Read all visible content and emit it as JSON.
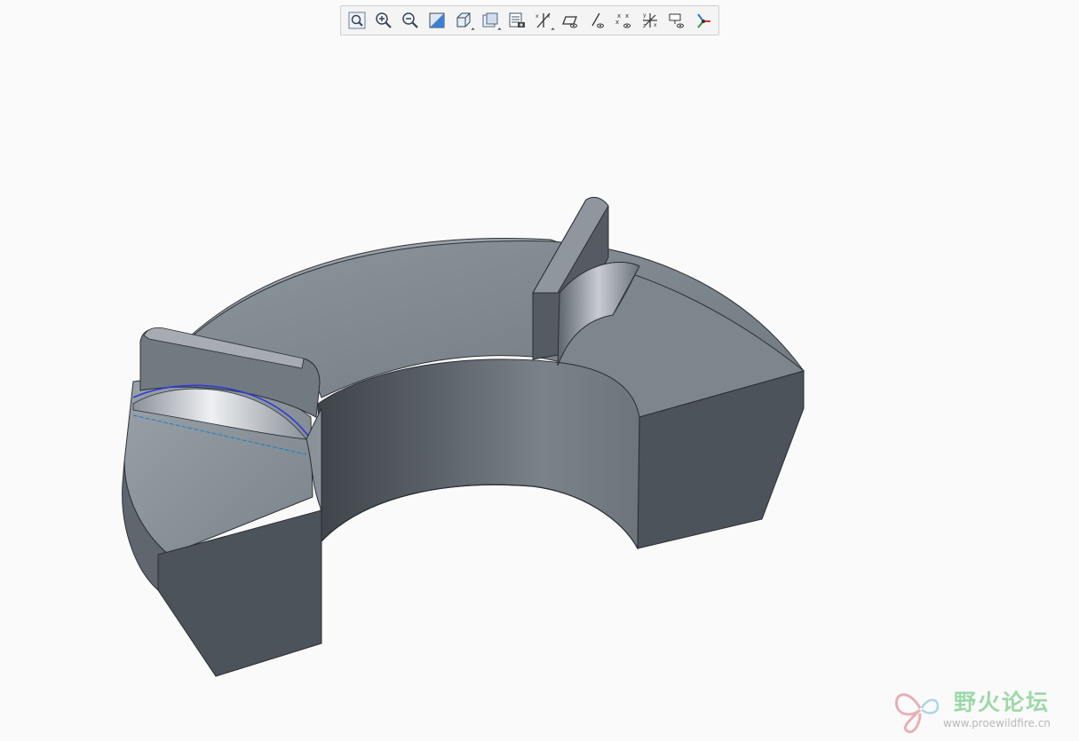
{
  "toolbar": {
    "buttons": [
      {
        "name": "refit",
        "icon": "refit-icon",
        "dropdown": false
      },
      {
        "name": "zoom-in",
        "icon": "zoom-in-icon",
        "dropdown": false
      },
      {
        "name": "zoom-out",
        "icon": "zoom-out-icon",
        "dropdown": false
      },
      {
        "name": "repaint",
        "icon": "repaint-icon",
        "dropdown": false
      },
      {
        "name": "display-style",
        "icon": "display-style-icon",
        "dropdown": true
      },
      {
        "name": "saved-orientations",
        "icon": "saved-orientations-icon",
        "dropdown": true
      },
      {
        "name": "view-manager",
        "icon": "view-manager-icon",
        "dropdown": false
      },
      {
        "name": "datum-display",
        "icon": "datum-display-icon",
        "dropdown": true
      },
      {
        "name": "plane-display",
        "icon": "plane-display-icon",
        "dropdown": false
      },
      {
        "name": "axis-display",
        "icon": "axis-display-icon",
        "dropdown": false
      },
      {
        "name": "point-display",
        "icon": "point-display-icon",
        "dropdown": false
      },
      {
        "name": "csys-display",
        "icon": "csys-display-icon",
        "dropdown": false
      },
      {
        "name": "annotation-display",
        "icon": "annotation-display-icon",
        "dropdown": false
      },
      {
        "name": "spin-center",
        "icon": "spin-center-icon",
        "dropdown": false
      }
    ]
  },
  "colors": {
    "background": "#fafafa",
    "model_face": "#7f878f",
    "model_dark": "#4a5058",
    "edge_highlight": "#2d3bd6",
    "axis_line": "#1a7fc9"
  },
  "watermark": {
    "name_cn": "野火论坛",
    "url": "www.proewildfire.cn"
  }
}
